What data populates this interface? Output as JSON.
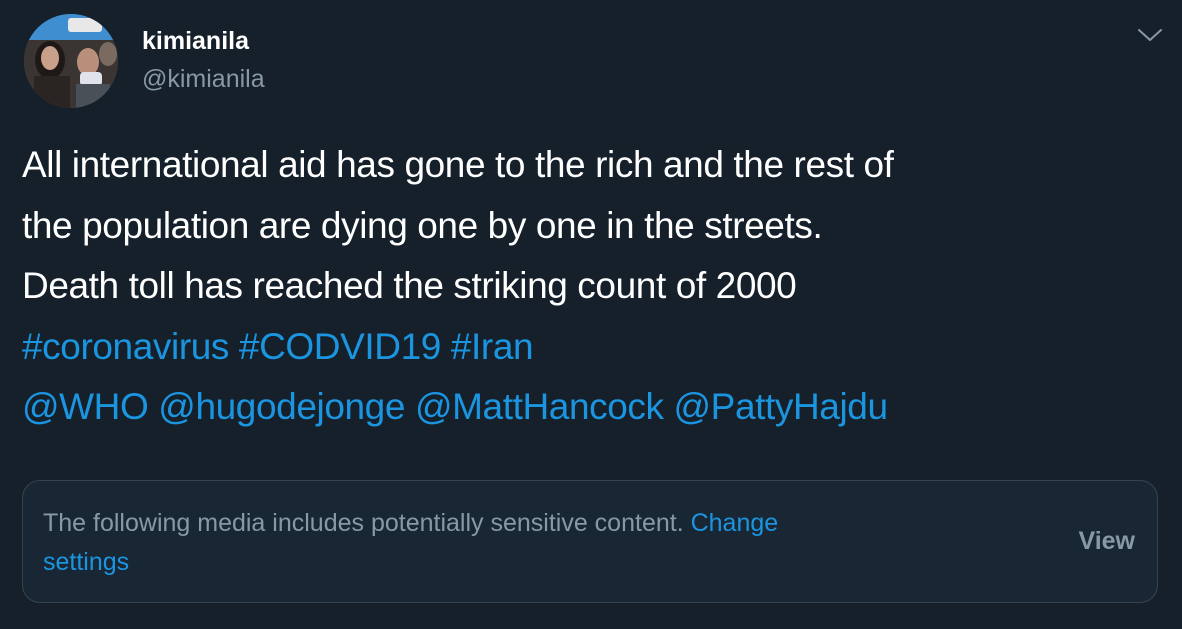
{
  "user": {
    "display_name": "kimianila",
    "handle": "@kimianila"
  },
  "tweet": {
    "lines": [
      "All international aid has gone to the rich and the rest of",
      "the population are dying one by one in the streets.",
      "Death toll has reached the striking count of 2000"
    ],
    "hashtags": [
      "#coronavirus",
      "#CODVID19",
      "#Iran"
    ],
    "mentions": [
      "@WHO",
      "@hugodejonge",
      "@MattHancock",
      "@PattyHajdu"
    ]
  },
  "sensitive": {
    "message": "The following media includes potentially sensitive content.",
    "change_link_line1": "Change",
    "change_link_line2": "settings",
    "view_label": "View"
  },
  "icons": {
    "menu": "chevron-down-icon"
  },
  "colors": {
    "background": "#15202b",
    "link": "#1b95e0",
    "secondary_text": "#8899a6",
    "card_background": "#192734",
    "card_border": "#38444d"
  }
}
